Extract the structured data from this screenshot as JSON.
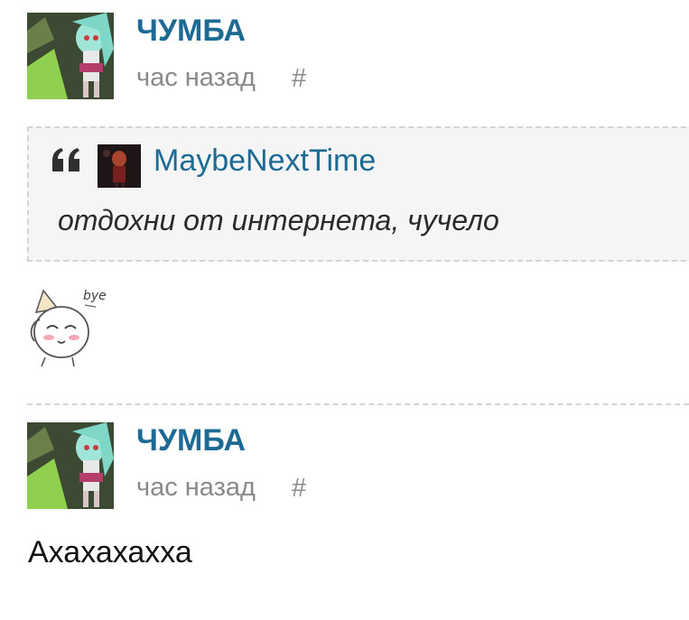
{
  "posts": [
    {
      "author": "ЧУМБА",
      "time": "час назад",
      "permalink": "#",
      "quote": {
        "author": "MaybeNextTime",
        "text": "отдохни от интернета, чучело"
      },
      "sticker_text": "bye"
    },
    {
      "author": "ЧУМБА",
      "time": "час назад",
      "permalink": "#",
      "body": "Ахахахахха"
    }
  ],
  "colors": {
    "link": "#1d6a95",
    "muted": "#8a8a8a",
    "quote_bg": "#f5f5f5",
    "divider": "#d4d4d4"
  },
  "icons": {
    "quote": "quote-marks-icon",
    "permalink": "hash-icon"
  }
}
